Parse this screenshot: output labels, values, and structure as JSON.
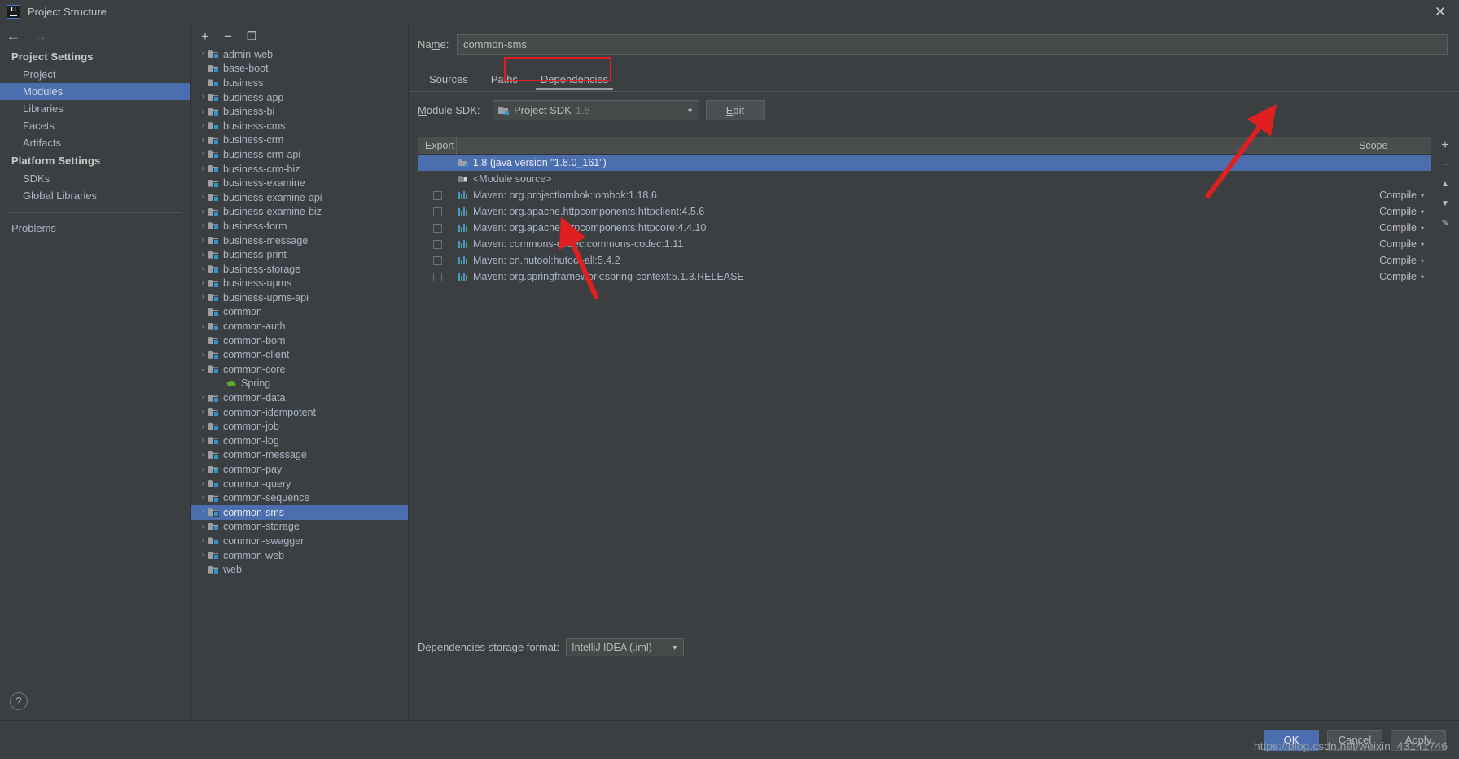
{
  "window": {
    "title": "Project Structure",
    "logo_text": "IJ",
    "close_label": "✕"
  },
  "nav": {
    "back": "←",
    "forward": "→"
  },
  "sidebar": {
    "groups": [
      {
        "label": "Project Settings",
        "items": [
          {
            "label": "Project",
            "selected": false
          },
          {
            "label": "Modules",
            "selected": true
          },
          {
            "label": "Libraries",
            "selected": false
          },
          {
            "label": "Facets",
            "selected": false
          },
          {
            "label": "Artifacts",
            "selected": false
          }
        ]
      },
      {
        "label": "Platform Settings",
        "items": [
          {
            "label": "SDKs",
            "selected": false
          },
          {
            "label": "Global Libraries",
            "selected": false
          }
        ]
      }
    ],
    "problems_label": "Problems",
    "help_label": "?"
  },
  "tree_toolbar": {
    "add": "+",
    "remove": "−",
    "copy": "❐"
  },
  "tree": {
    "items": [
      {
        "label": "admin-web",
        "expandable": true,
        "expanded": false,
        "type": "module",
        "selected": false,
        "indent": 0
      },
      {
        "label": "base-boot",
        "expandable": false,
        "expanded": false,
        "type": "module",
        "selected": false,
        "indent": 0
      },
      {
        "label": "business",
        "expandable": false,
        "expanded": false,
        "type": "module",
        "selected": false,
        "indent": 0
      },
      {
        "label": "business-app",
        "expandable": true,
        "expanded": false,
        "type": "module",
        "selected": false,
        "indent": 0
      },
      {
        "label": "business-bi",
        "expandable": true,
        "expanded": false,
        "type": "module",
        "selected": false,
        "indent": 0
      },
      {
        "label": "business-cms",
        "expandable": true,
        "expanded": false,
        "type": "module",
        "selected": false,
        "indent": 0
      },
      {
        "label": "business-crm",
        "expandable": true,
        "expanded": false,
        "type": "module",
        "selected": false,
        "indent": 0
      },
      {
        "label": "business-crm-api",
        "expandable": true,
        "expanded": false,
        "type": "module",
        "selected": false,
        "indent": 0
      },
      {
        "label": "business-crm-biz",
        "expandable": true,
        "expanded": false,
        "type": "module",
        "selected": false,
        "indent": 0
      },
      {
        "label": "business-examine",
        "expandable": false,
        "expanded": false,
        "type": "module",
        "selected": false,
        "indent": 0
      },
      {
        "label": "business-examine-api",
        "expandable": true,
        "expanded": false,
        "type": "module",
        "selected": false,
        "indent": 0
      },
      {
        "label": "business-examine-biz",
        "expandable": true,
        "expanded": false,
        "type": "module",
        "selected": false,
        "indent": 0
      },
      {
        "label": "business-form",
        "expandable": true,
        "expanded": false,
        "type": "module",
        "selected": false,
        "indent": 0
      },
      {
        "label": "business-message",
        "expandable": true,
        "expanded": false,
        "type": "module",
        "selected": false,
        "indent": 0
      },
      {
        "label": "business-print",
        "expandable": true,
        "expanded": false,
        "type": "module",
        "selected": false,
        "indent": 0
      },
      {
        "label": "business-storage",
        "expandable": true,
        "expanded": false,
        "type": "module",
        "selected": false,
        "indent": 0
      },
      {
        "label": "business-upms",
        "expandable": true,
        "expanded": false,
        "type": "module",
        "selected": false,
        "indent": 0
      },
      {
        "label": "business-upms-api",
        "expandable": true,
        "expanded": false,
        "type": "module",
        "selected": false,
        "indent": 0
      },
      {
        "label": "common",
        "expandable": false,
        "expanded": false,
        "type": "module",
        "selected": false,
        "indent": 0
      },
      {
        "label": "common-auth",
        "expandable": true,
        "expanded": false,
        "type": "module",
        "selected": false,
        "indent": 0
      },
      {
        "label": "common-bom",
        "expandable": false,
        "expanded": false,
        "type": "module",
        "selected": false,
        "indent": 0
      },
      {
        "label": "common-client",
        "expandable": true,
        "expanded": false,
        "type": "module",
        "selected": false,
        "indent": 0
      },
      {
        "label": "common-core",
        "expandable": true,
        "expanded": true,
        "type": "module",
        "selected": false,
        "indent": 0
      },
      {
        "label": "Spring",
        "expandable": false,
        "expanded": false,
        "type": "spring",
        "selected": false,
        "indent": 1
      },
      {
        "label": "common-data",
        "expandable": true,
        "expanded": false,
        "type": "module",
        "selected": false,
        "indent": 0
      },
      {
        "label": "common-idempotent",
        "expandable": true,
        "expanded": false,
        "type": "module",
        "selected": false,
        "indent": 0
      },
      {
        "label": "common-job",
        "expandable": true,
        "expanded": false,
        "type": "module",
        "selected": false,
        "indent": 0
      },
      {
        "label": "common-log",
        "expandable": true,
        "expanded": false,
        "type": "module",
        "selected": false,
        "indent": 0
      },
      {
        "label": "common-message",
        "expandable": true,
        "expanded": false,
        "type": "module",
        "selected": false,
        "indent": 0
      },
      {
        "label": "common-pay",
        "expandable": true,
        "expanded": false,
        "type": "module",
        "selected": false,
        "indent": 0
      },
      {
        "label": "common-query",
        "expandable": true,
        "expanded": false,
        "type": "module",
        "selected": false,
        "indent": 0
      },
      {
        "label": "common-sequence",
        "expandable": true,
        "expanded": false,
        "type": "module",
        "selected": false,
        "indent": 0
      },
      {
        "label": "common-sms",
        "expandable": true,
        "expanded": false,
        "type": "module",
        "selected": true,
        "indent": 0
      },
      {
        "label": "common-storage",
        "expandable": true,
        "expanded": false,
        "type": "module",
        "selected": false,
        "indent": 0
      },
      {
        "label": "common-swagger",
        "expandable": true,
        "expanded": false,
        "type": "module",
        "selected": false,
        "indent": 0
      },
      {
        "label": "common-web",
        "expandable": true,
        "expanded": false,
        "type": "module",
        "selected": false,
        "indent": 0
      },
      {
        "label": "web",
        "expandable": false,
        "expanded": false,
        "type": "module",
        "selected": false,
        "indent": 0
      }
    ]
  },
  "detail": {
    "name_label": "Name:",
    "name_value": "common-sms",
    "tabs": [
      {
        "label": "Sources",
        "active": false
      },
      {
        "label": "Paths",
        "active": false
      },
      {
        "label": "Dependencies",
        "active": true
      }
    ],
    "sdk_label": "Module SDK:",
    "sdk_value": "Project SDK",
    "sdk_value_dim": "1.8",
    "edit_button": "Edit",
    "columns": {
      "export": "Export",
      "scope": "Scope"
    },
    "rows": [
      {
        "name": "1.8 (java version \"1.8.0_161\")",
        "icon": "sdk-icon",
        "checkbox": false,
        "checked": false,
        "scope": "",
        "selected": true
      },
      {
        "name": "<Module source>",
        "icon": "module-source-icon",
        "checkbox": false,
        "checked": false,
        "scope": "",
        "selected": false
      },
      {
        "name": "Maven: org.projectlombok:lombok:1.18.6",
        "icon": "jar-icon",
        "checkbox": true,
        "checked": false,
        "scope": "Compile",
        "selected": false
      },
      {
        "name": "Maven: org.apache.httpcomponents:httpclient:4.5.6",
        "icon": "jar-icon",
        "checkbox": true,
        "checked": false,
        "scope": "Compile",
        "selected": false
      },
      {
        "name": "Maven: org.apache.httpcomponents:httpcore:4.4.10",
        "icon": "jar-icon",
        "checkbox": true,
        "checked": false,
        "scope": "Compile",
        "selected": false
      },
      {
        "name": "Maven: commons-codec:commons-codec:1.11",
        "icon": "jar-icon",
        "checkbox": true,
        "checked": false,
        "scope": "Compile",
        "selected": false
      },
      {
        "name": "Maven: cn.hutool:hutool-all:5.4.2",
        "icon": "jar-icon",
        "checkbox": true,
        "checked": false,
        "scope": "Compile",
        "selected": false
      },
      {
        "name": "Maven: org.springframework:spring-context:5.1.3.RELEASE",
        "icon": "jar-icon",
        "checkbox": true,
        "checked": false,
        "scope": "Compile",
        "selected": false
      }
    ],
    "side_tools": {
      "add": "+",
      "remove": "−",
      "up": "▲",
      "down": "▼",
      "edit": "✎"
    },
    "storage_label": "Dependencies storage format:",
    "storage_value": "IntelliJ IDEA (.iml)",
    "scope_caret": "▾"
  },
  "bottom": {
    "ok": "OK",
    "cancel": "Cancel",
    "apply": "Apply",
    "watermark": "https://blog.csdn.net/weixin_43141746"
  },
  "colors": {
    "selection": "#4b6eaf",
    "annotation": "#e02020",
    "background": "#3c3f41",
    "text": "#a9b7c6"
  }
}
